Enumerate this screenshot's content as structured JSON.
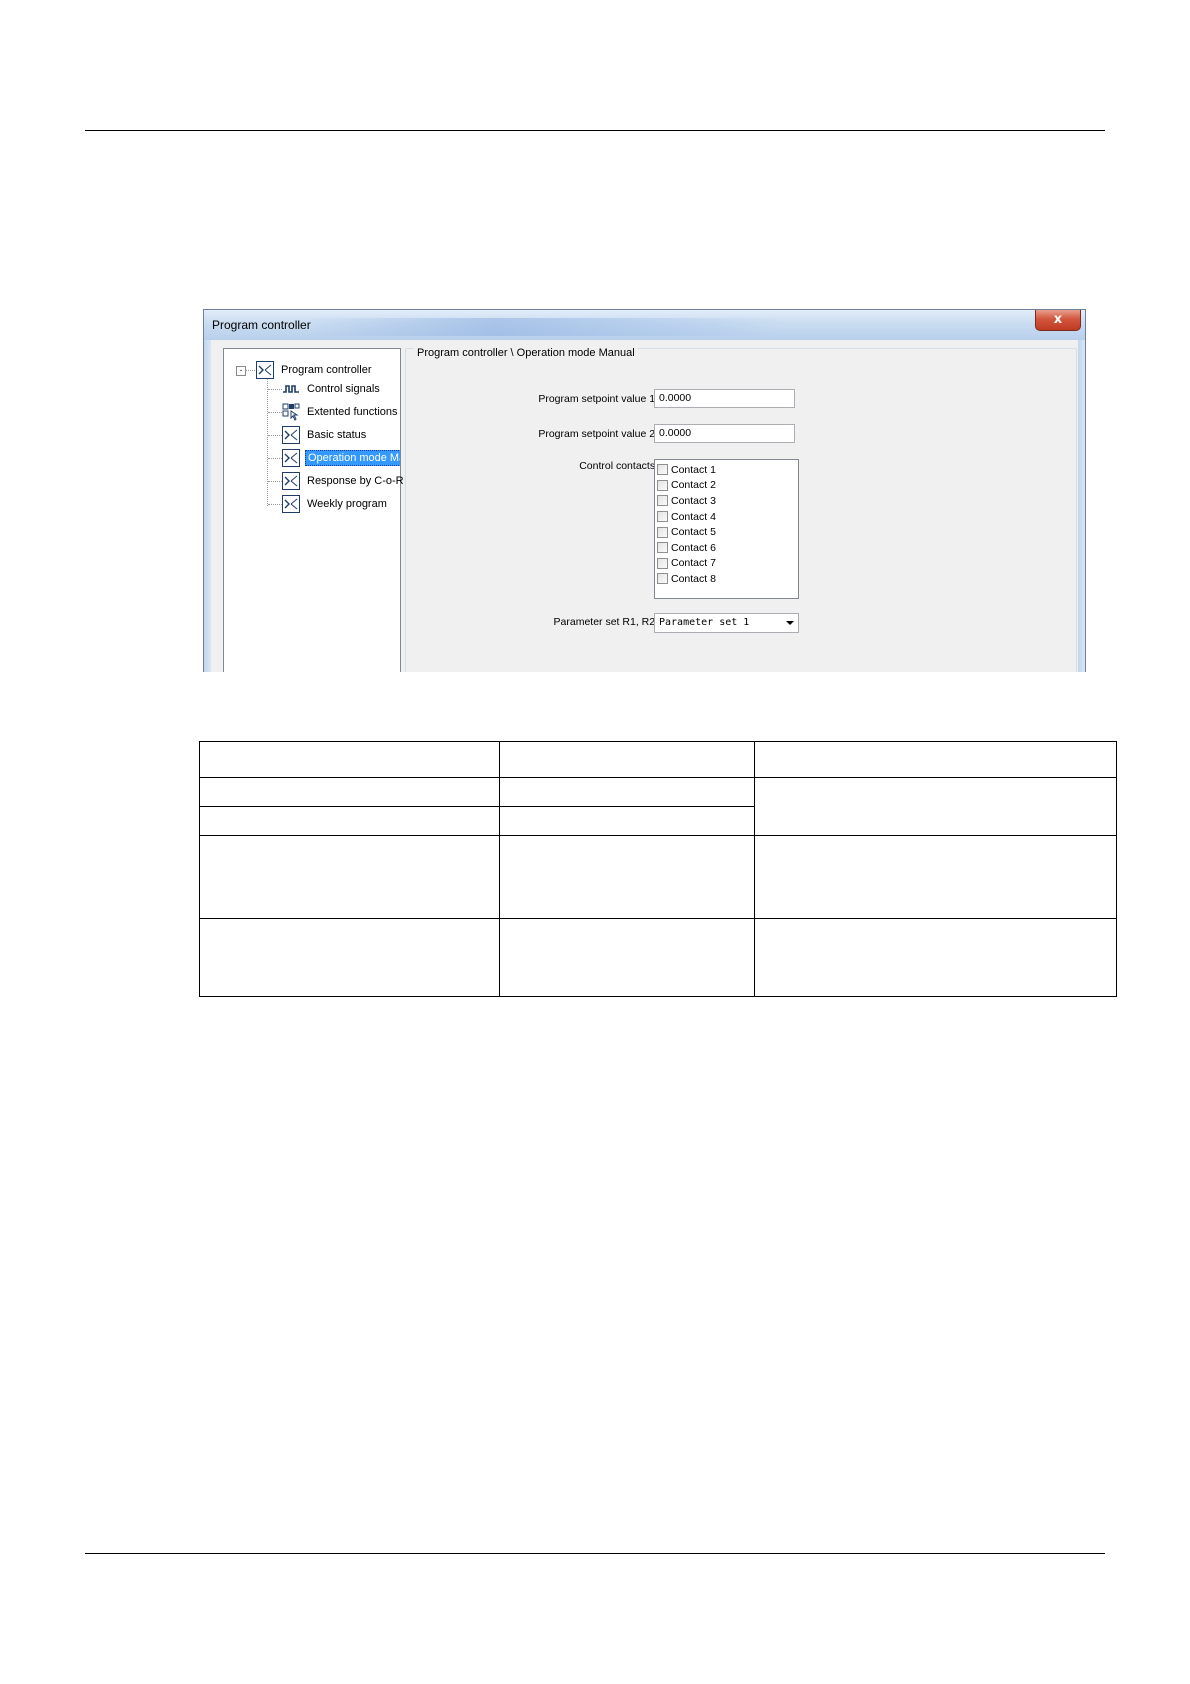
{
  "window": {
    "title": "Program controller",
    "close_glyph": "x"
  },
  "tree": {
    "root": "Program controller",
    "expander": "-",
    "items": [
      {
        "label": "Control signals",
        "icon": "pulse-icon"
      },
      {
        "label": "Extented functions",
        "icon": "functions-icon"
      },
      {
        "label": "Basic status",
        "icon": "program-icon"
      },
      {
        "label": "Operation mode Manual",
        "icon": "program-icon",
        "selected": true
      },
      {
        "label": "Response by C-o-R",
        "icon": "program-icon"
      },
      {
        "label": "Weekly program",
        "icon": "program-icon"
      }
    ]
  },
  "panel": {
    "title": "Program controller \\ Operation mode Manual",
    "setpoint1_label": "Program setpoint value 1:",
    "setpoint1_value": "0.0000",
    "setpoint2_label": "Program setpoint value 2:",
    "setpoint2_value": "0.0000",
    "contacts_label": "Control contacts:",
    "contacts": [
      "Contact 1",
      "Contact 2",
      "Contact 3",
      "Contact 4",
      "Contact 5",
      "Contact 6",
      "Contact 7",
      "Contact 8"
    ],
    "param_label": "Parameter set R1, R2:",
    "param_value": "Parameter set 1"
  }
}
